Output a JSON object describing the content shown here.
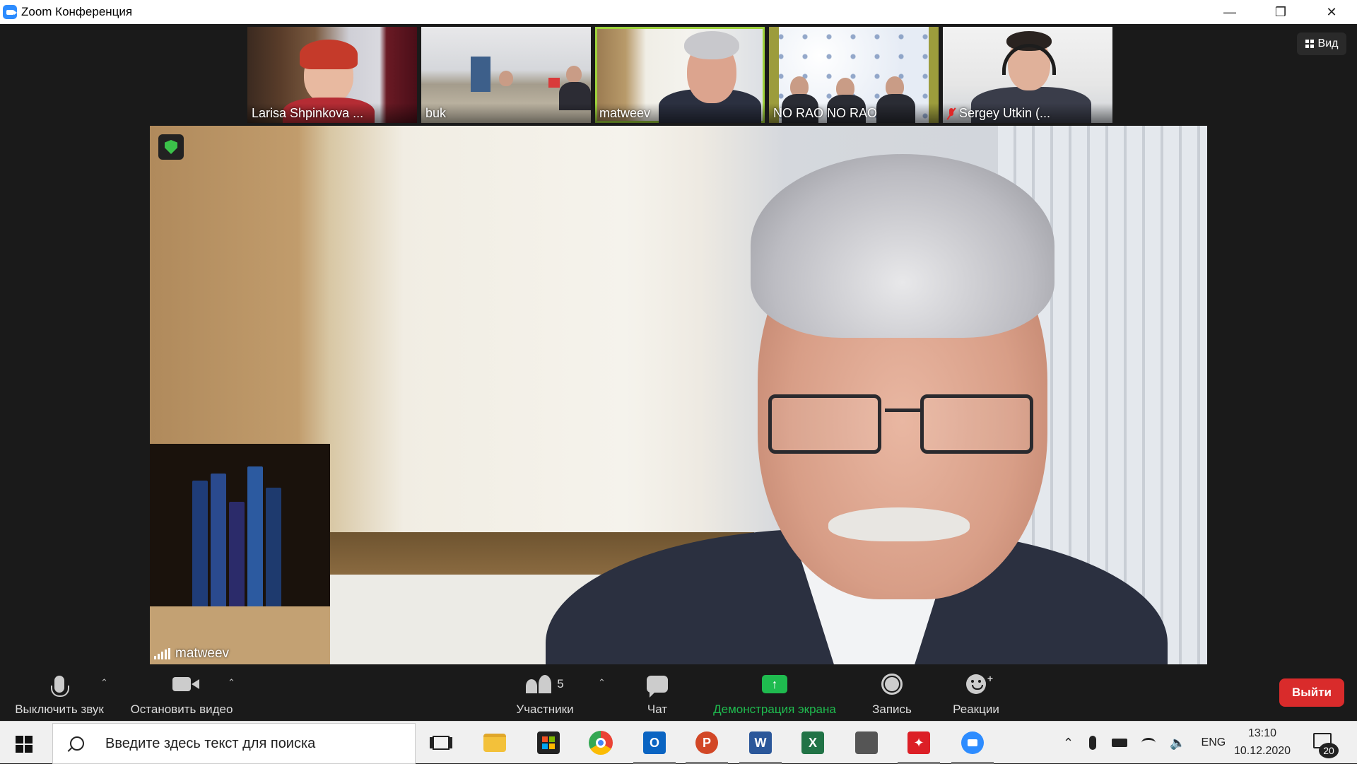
{
  "window": {
    "title": "Zoom Конференция"
  },
  "view_button": {
    "label": "Вид"
  },
  "thumbnails": [
    {
      "name": "Larisa Shpinkova ...",
      "muted": false,
      "active": false
    },
    {
      "name": "buk",
      "muted": false,
      "active": false
    },
    {
      "name": "matweev",
      "muted": false,
      "active": true
    },
    {
      "name": "NO RAO NO RAO",
      "muted": false,
      "active": false
    },
    {
      "name": "Sergey Utkin (...",
      "muted": true,
      "active": false
    }
  ],
  "main_video": {
    "speaker_name": "matweev"
  },
  "toolbar": {
    "mute_label": "Выключить звук",
    "video_label": "Остановить видео",
    "participants_label": "Участники",
    "participants_count": "5",
    "chat_label": "Чат",
    "share_label": "Демонстрация экрана",
    "record_label": "Запись",
    "reactions_label": "Реакции",
    "leave_label": "Выйти"
  },
  "colors": {
    "share_accent": "#1fbb4f",
    "leave_red": "#d92b2b",
    "active_border": "#9ed23b",
    "zoom_blue": "#2d8cff"
  },
  "taskbar": {
    "search_placeholder": "Введите здесь текст для поиска",
    "apps": [
      "task-view-icon",
      "file-explorer-icon",
      "store-icon",
      "chrome-icon",
      "outlook-icon",
      "powerpoint-icon",
      "word-icon",
      "excel-icon",
      "calculator-icon",
      "acrobat-icon",
      "zoom-icon"
    ],
    "language": "ENG",
    "time": "13:10",
    "date": "10.12.2020",
    "notifications": "20"
  }
}
